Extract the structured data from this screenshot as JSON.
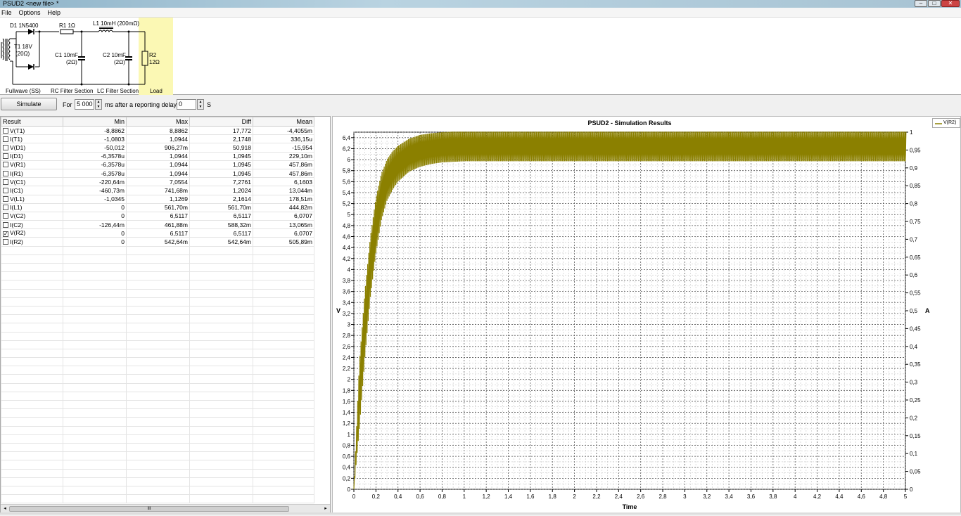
{
  "window": {
    "title": "PSUD2  <new file> *",
    "minimize": "–",
    "maximize": "□",
    "close": "✕"
  },
  "menu": [
    "File",
    "Options",
    "Help"
  ],
  "schematic": {
    "d1": "D1 1N5400",
    "r1": "R1 1Ω",
    "l1": "L1 10mH (200mΩ)",
    "t1": "T1 18V",
    "t1_r": "(20Ω)",
    "c1": "C1 10mF",
    "c1_r": "(2Ω)",
    "c2": "C2 10mF",
    "c2_r": "(2Ω)",
    "r2": "R2",
    "r2_v": "12Ω",
    "sec_fullwave": "Fullwave (SS)",
    "sec_rc": "RC Filter Section",
    "sec_lc": "LC Filter Section",
    "sec_load": "Load"
  },
  "toolbar": {
    "simulate": "Simulate",
    "for": "For",
    "duration": "5 000",
    "ms_text": "ms  after a reporting delay of",
    "delay": "0",
    "s": "S"
  },
  "table": {
    "headers": [
      "Result",
      "Min",
      "Max",
      "Diff",
      "Mean"
    ],
    "rows": [
      {
        "name": "V(T1)",
        "checked": false,
        "min": "-8,8862",
        "max": "8,8862",
        "diff": "17,772",
        "mean": "-4,4055m"
      },
      {
        "name": "I(T1)",
        "checked": false,
        "min": "-1,0803",
        "max": "1,0944",
        "diff": "2,1748",
        "mean": "336,15u"
      },
      {
        "name": "V(D1)",
        "checked": false,
        "min": "-50,012",
        "max": "906,27m",
        "diff": "50,918",
        "mean": "-15,954"
      },
      {
        "name": "I(D1)",
        "checked": false,
        "min": "-6,3578u",
        "max": "1,0944",
        "diff": "1,0945",
        "mean": "229,10m"
      },
      {
        "name": "V(R1)",
        "checked": false,
        "min": "-6,3578u",
        "max": "1,0944",
        "diff": "1,0945",
        "mean": "457,86m"
      },
      {
        "name": "I(R1)",
        "checked": false,
        "min": "-6,3578u",
        "max": "1,0944",
        "diff": "1,0945",
        "mean": "457,86m"
      },
      {
        "name": "V(C1)",
        "checked": false,
        "min": "-220,64m",
        "max": "7,0554",
        "diff": "7,2761",
        "mean": "6,1603"
      },
      {
        "name": "I(C1)",
        "checked": false,
        "min": "-460,73m",
        "max": "741,68m",
        "diff": "1,2024",
        "mean": "13,044m"
      },
      {
        "name": "V(L1)",
        "checked": false,
        "min": "-1,0345",
        "max": "1,1269",
        "diff": "2,1614",
        "mean": "178,51m"
      },
      {
        "name": "I(L1)",
        "checked": false,
        "min": "0",
        "max": "561,70m",
        "diff": "561,70m",
        "mean": "444,82m"
      },
      {
        "name": "V(C2)",
        "checked": false,
        "min": "0",
        "max": "6,5117",
        "diff": "6,5117",
        "mean": "6,0707"
      },
      {
        "name": "I(C2)",
        "checked": false,
        "min": "-126,44m",
        "max": "461,88m",
        "diff": "588,32m",
        "mean": "13,065m"
      },
      {
        "name": "V(R2)",
        "checked": true,
        "min": "0",
        "max": "6,5117",
        "diff": "6,5117",
        "mean": "6,0707"
      },
      {
        "name": "I(R2)",
        "checked": false,
        "min": "0",
        "max": "542,64m",
        "diff": "542,64m",
        "mean": "505,89m"
      }
    ],
    "scroll_thumb": "III",
    "scroll_left": "◂",
    "scroll_right": "▸"
  },
  "chart_data": {
    "type": "line",
    "title": "PSUD2 - Simulation Results",
    "xlabel": "Time",
    "ylabel_left": "V",
    "ylabel_right": "A",
    "xlim": [
      0,
      5
    ],
    "ylim_left": [
      0,
      6.5
    ],
    "ylim_right": [
      0,
      1
    ],
    "grid": true,
    "legend_position": "top-right",
    "x_ticks": [
      "0",
      "0,2",
      "0,4",
      "0,6",
      "0,8",
      "1",
      "1,2",
      "1,4",
      "1,6",
      "1,8",
      "2",
      "2,2",
      "2,4",
      "2,6",
      "2,8",
      "3",
      "3,2",
      "3,4",
      "3,6",
      "3,8",
      "4",
      "4,2",
      "4,4",
      "4,6",
      "4,8",
      "5"
    ],
    "y_ticks_left": [
      "0",
      "0,2",
      "0,4",
      "0,6",
      "0,8",
      "1",
      "1,2",
      "1,4",
      "1,6",
      "1,8",
      "2",
      "2,2",
      "2,4",
      "2,6",
      "2,8",
      "3",
      "3,2",
      "3,4",
      "3,6",
      "3,8",
      "4",
      "4,2",
      "4,4",
      "4,6",
      "4,8",
      "5",
      "5,2",
      "5,4",
      "5,6",
      "5,8",
      "6",
      "6,2",
      "6,4"
    ],
    "y_ticks_right": [
      "0",
      "0,05",
      "0,1",
      "0,15",
      "0,2",
      "0,25",
      "0,3",
      "0,35",
      "0,4",
      "0,45",
      "0,5",
      "0,55",
      "0,6",
      "0,65",
      "0,7",
      "0,75",
      "0,8",
      "0,85",
      "0,9",
      "0,95",
      "1"
    ],
    "series": [
      {
        "name": "V(R2)",
        "color": "#8b8000",
        "envelope": {
          "x": [
            0,
            0.05,
            0.1,
            0.15,
            0.2,
            0.25,
            0.3,
            0.35,
            0.4,
            0.5,
            0.6,
            0.7,
            0.8,
            0.9,
            1.0,
            1.5,
            2.0,
            3.0,
            4.0,
            5.0
          ],
          "upper": [
            0,
            2.3,
            3.6,
            4.6,
            5.3,
            5.75,
            6.0,
            6.15,
            6.25,
            6.38,
            6.45,
            6.48,
            6.5,
            6.51,
            6.51,
            6.51,
            6.51,
            6.51,
            6.51,
            6.51
          ],
          "lower": [
            0,
            1.1,
            2.4,
            3.5,
            4.3,
            4.9,
            5.25,
            5.45,
            5.6,
            5.78,
            5.87,
            5.92,
            5.95,
            5.96,
            5.97,
            5.97,
            5.97,
            5.97,
            5.97,
            5.97
          ]
        },
        "ripple_hz": 100
      }
    ]
  }
}
